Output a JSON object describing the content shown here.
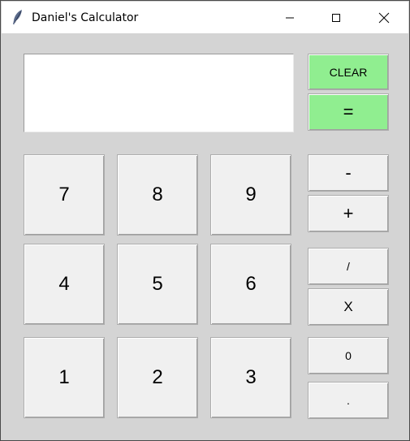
{
  "window": {
    "title": "Daniel's Calculator",
    "icon": "feather-icon"
  },
  "display": {
    "value": ""
  },
  "buttons": {
    "clear": "CLEAR",
    "equals": "=",
    "minus": "-",
    "plus": "+",
    "divide": "/",
    "multiply": "X",
    "zero": "0",
    "dot": ".",
    "seven": "7",
    "eight": "8",
    "nine": "9",
    "four": "4",
    "five": "5",
    "six": "6",
    "one": "1",
    "two": "2",
    "three": "3"
  },
  "colors": {
    "accent_button": "#90ee90",
    "window_background": "#d4d4d4",
    "button_face": "#f0f0f0"
  }
}
